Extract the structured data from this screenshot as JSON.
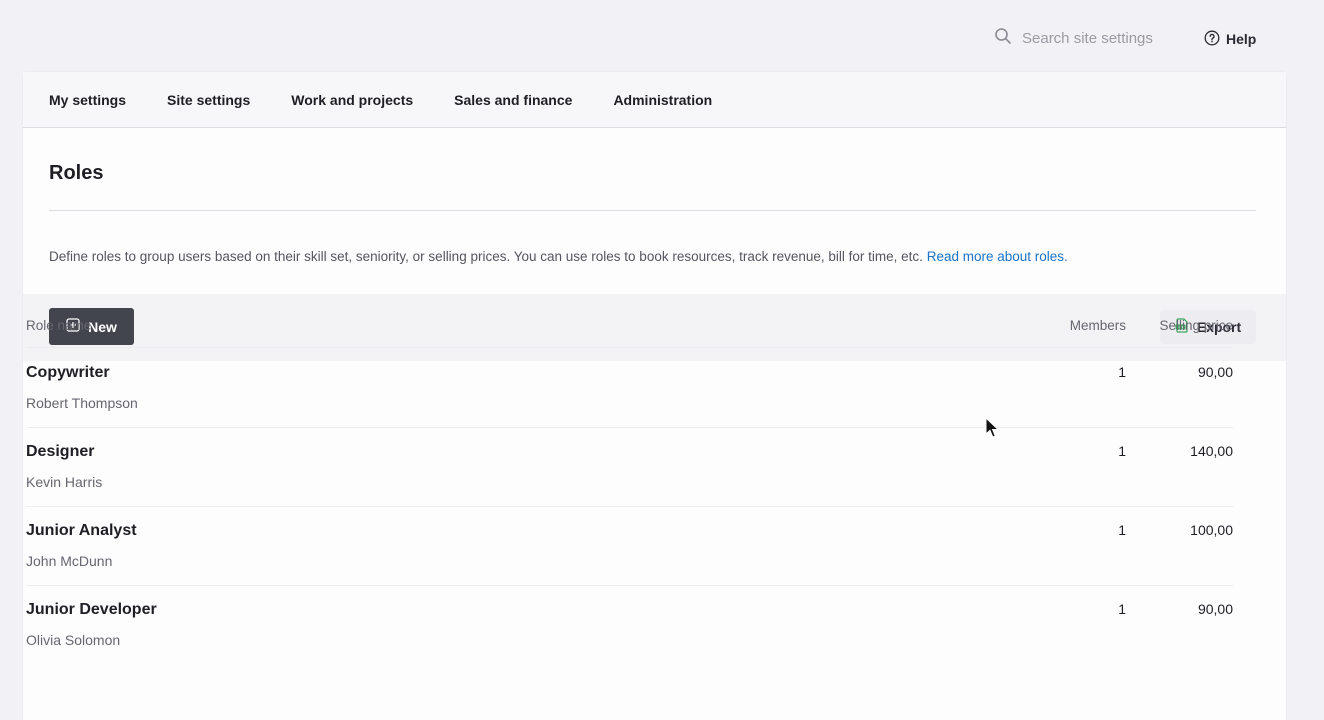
{
  "header": {
    "search_placeholder": "Search site settings",
    "help_label": "Help"
  },
  "nav": {
    "tabs": [
      {
        "label": "My settings"
      },
      {
        "label": "Site settings"
      },
      {
        "label": "Work and projects"
      },
      {
        "label": "Sales and finance"
      },
      {
        "label": "Administration"
      }
    ]
  },
  "page": {
    "title": "Roles",
    "description": "Define roles to group users based on their skill set, seniority, or selling prices. You can use roles to book resources, track revenue, bill for time, etc.",
    "read_more_link": "Read more about roles."
  },
  "toolbar": {
    "new_label": "New",
    "export_label": "Export"
  },
  "table": {
    "columns": {
      "name": "Role name",
      "members": "Members",
      "price": "Selling price"
    },
    "rows": [
      {
        "name": "Copywriter",
        "member": "Robert Thompson",
        "count": "1",
        "price": "90,00"
      },
      {
        "name": "Designer",
        "member": "Kevin Harris",
        "count": "1",
        "price": "140,00"
      },
      {
        "name": "Junior Analyst",
        "member": "John McDunn",
        "count": "1",
        "price": "100,00"
      },
      {
        "name": "Junior Developer",
        "member": "Olivia Solomon",
        "count": "1",
        "price": "90,00"
      }
    ]
  },
  "icons": {
    "search": "search-icon",
    "help": "help-circle-icon",
    "new": "plus-square-icon",
    "export": "csv-file-icon",
    "cursor": "mouse-pointer-icon"
  },
  "colors": {
    "link": "#1a73c7",
    "primary_button": "#42454e",
    "csv_icon": "#3aa55b"
  }
}
